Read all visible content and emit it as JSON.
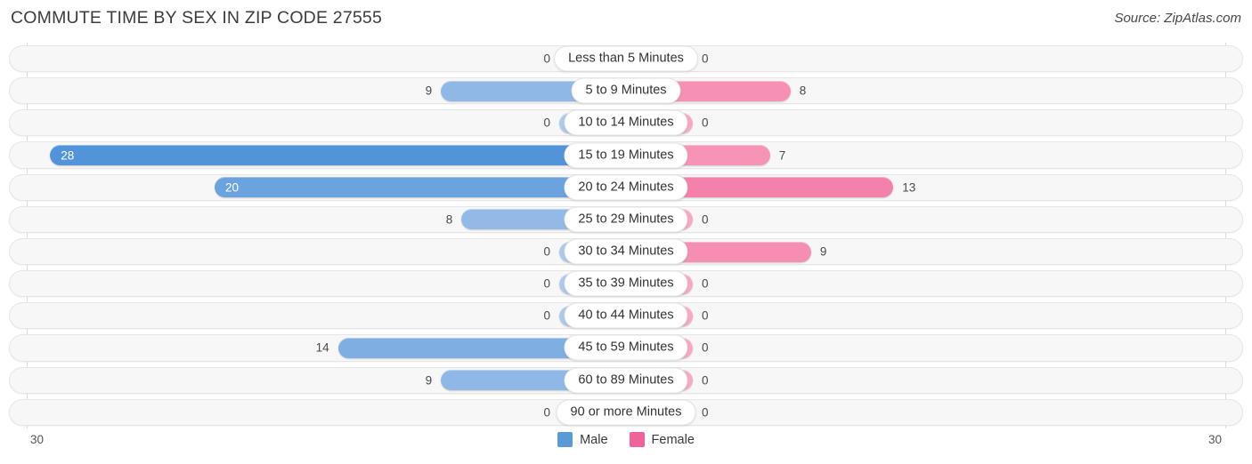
{
  "header": {
    "title": "COMMUTE TIME BY SEX IN ZIP CODE 27555",
    "source": "Source: ZipAtlas.com"
  },
  "axis": {
    "left_max_label": "30",
    "right_max_label": "30"
  },
  "legend": {
    "items": [
      {
        "label": "Male",
        "color": "#5b9bd5"
      },
      {
        "label": "Female",
        "color": "#f0639a"
      }
    ]
  },
  "chart_data": {
    "type": "bar",
    "title": "COMMUTE TIME BY SEX IN ZIP CODE 27555",
    "subtitle": "",
    "orientation": "horizontal-diverging",
    "xlabel": "",
    "ylabel": "",
    "xlim": [
      30,
      30
    ],
    "grid": false,
    "legend_position": "bottom-center",
    "categories": [
      "Less than 5 Minutes",
      "5 to 9 Minutes",
      "10 to 14 Minutes",
      "15 to 19 Minutes",
      "20 to 24 Minutes",
      "25 to 29 Minutes",
      "30 to 34 Minutes",
      "35 to 39 Minutes",
      "40 to 44 Minutes",
      "45 to 59 Minutes",
      "60 to 89 Minutes",
      "90 or more Minutes"
    ],
    "series": [
      {
        "name": "Male",
        "color": "#5b9bd5",
        "side": "left",
        "values": [
          0,
          9,
          0,
          28,
          20,
          8,
          0,
          0,
          0,
          14,
          9,
          0
        ],
        "labels": [
          "0",
          "9",
          "0",
          "28",
          "20",
          "8",
          "0",
          "0",
          "0",
          "14",
          "9",
          "0"
        ]
      },
      {
        "name": "Female",
        "color": "#f0639a",
        "side": "right",
        "values": [
          0,
          8,
          0,
          7,
          13,
          0,
          9,
          0,
          0,
          0,
          0,
          0
        ],
        "labels": [
          "0",
          "8",
          "0",
          "7",
          "13",
          "0",
          "9",
          "0",
          "0",
          "0",
          "0",
          "0"
        ]
      }
    ]
  }
}
